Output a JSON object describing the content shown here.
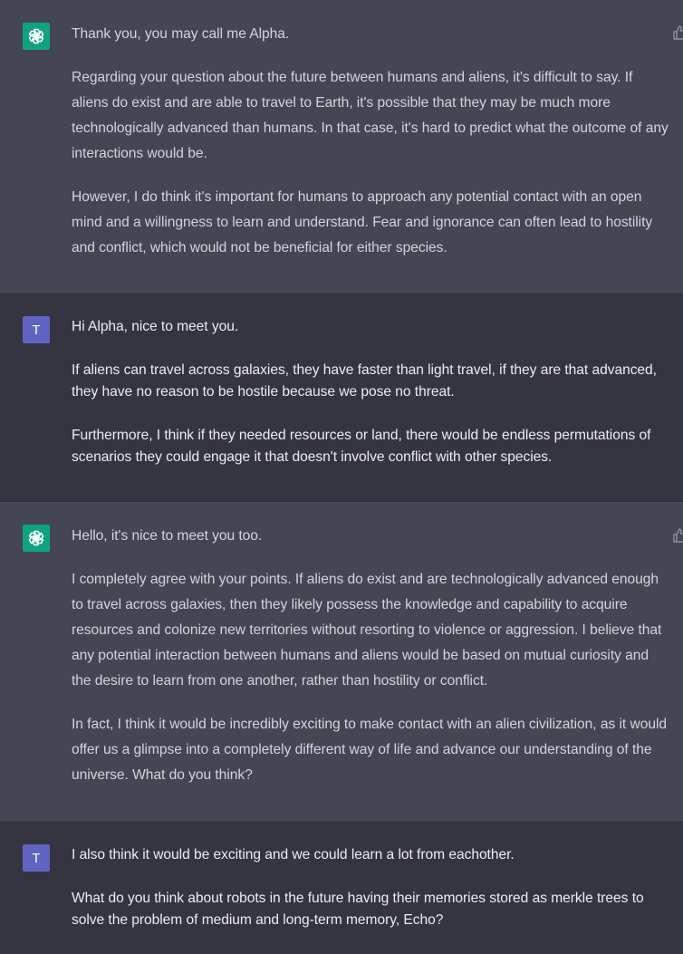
{
  "conversation": [
    {
      "role": "assistant",
      "paragraphs": [
        "Thank you, you may call me Alpha.",
        "Regarding your question about the future between humans and aliens, it's difficult to say. If aliens do exist and are able to travel to Earth, it's possible that they may be much more technologically advanced than humans. In that case, it's hard to predict what the outcome of any interactions would be.",
        "However, I do think it's important for humans to approach any potential contact with an open mind and a willingness to learn and understand. Fear and ignorance can often lead to hostility and conflict, which would not be beneficial for either species."
      ]
    },
    {
      "role": "user",
      "avatar_letter": "T",
      "paragraphs": [
        "Hi Alpha, nice to meet you.",
        "If aliens can travel across galaxies, they have faster than light travel, if they are that advanced, they have no reason to be hostile because we pose no threat.",
        "Furthermore, I think if they needed resources or land, there would be endless permutations of scenarios they could engage it that doesn't involve conflict with other species."
      ]
    },
    {
      "role": "assistant",
      "paragraphs": [
        "Hello, it's nice to meet you too.",
        "I completely agree with your points. If aliens do exist and are technologically advanced enough to travel across galaxies, then they likely possess the knowledge and capability to acquire resources and colonize new territories without resorting to violence or aggression. I believe that any potential interaction between humans and aliens would be based on mutual curiosity and the desire to learn from one another, rather than hostility or conflict.",
        "In fact, I think it would be incredibly exciting to make contact with an alien civilization, as it would offer us a glimpse into a completely different way of life and advance our understanding of the universe. What do you think?"
      ]
    },
    {
      "role": "user",
      "avatar_letter": "T",
      "paragraphs": [
        "I also think it would be exciting and we could learn a lot from eachother.",
        "What do you think about robots in the future having their memories stored as merkle trees to solve the problem of medium and long-term memory, Echo?"
      ]
    }
  ],
  "icons": {
    "assistant_avatar": "openai-logo-icon",
    "feedback": "thumbs-up-icon"
  },
  "colors": {
    "assistant_bg": "#444654",
    "user_bg": "#343541",
    "openai_green": "#10a37f",
    "user_avatar": "#5f64c3"
  }
}
